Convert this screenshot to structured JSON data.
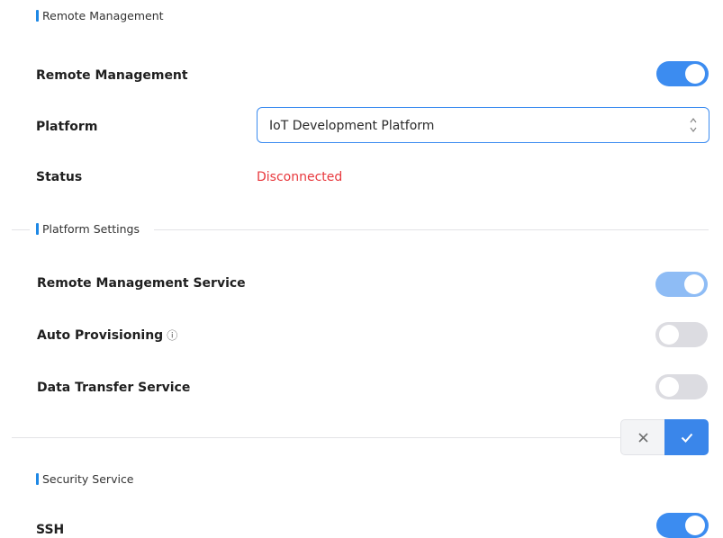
{
  "sections": {
    "remote_management": {
      "title": "Remote Management",
      "remote_management_label": "Remote Management",
      "platform_label": "Platform",
      "platform_value": "IoT Development Platform",
      "status_label": "Status",
      "status_value": "Disconnected"
    },
    "platform_settings": {
      "title": "Platform Settings",
      "remote_management_service_label": "Remote Management Service",
      "auto_provisioning_label": "Auto Provisioning",
      "auto_provisioning_info": "ⓘ",
      "data_transfer_service_label": "Data Transfer Service"
    },
    "security_service": {
      "title": "Security Service",
      "ssh_label": "SSH"
    }
  },
  "toggles": {
    "remote_management": "on",
    "remote_management_service": "on (disabled)",
    "auto_provisioning": "off",
    "data_transfer_service": "off",
    "ssh": "on"
  },
  "actions": {
    "cancel_icon": "close-icon",
    "confirm_icon": "check-icon"
  },
  "colors": {
    "accent": "#3c8cf0",
    "status_disconnected": "#e8383d",
    "toggle_off": "#dcdce1"
  }
}
